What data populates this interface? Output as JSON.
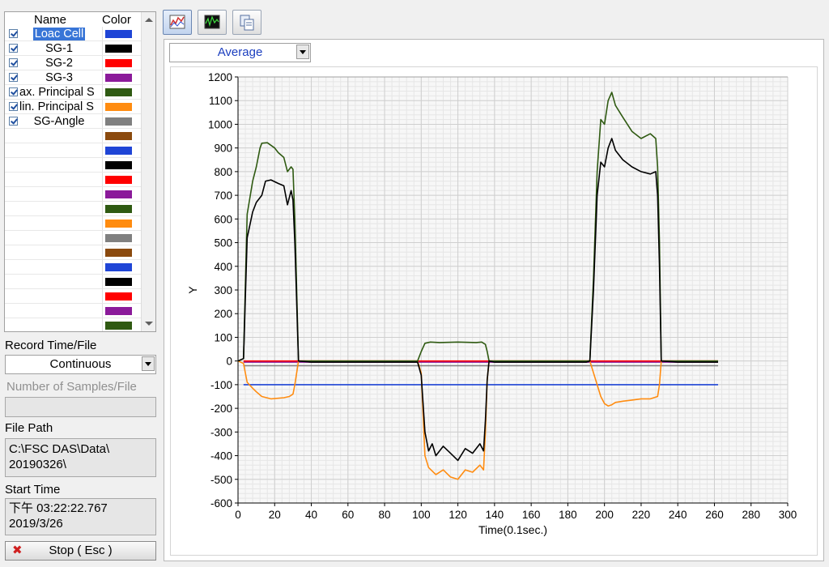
{
  "channel_table": {
    "headers": {
      "name": "Name",
      "color": "Color"
    },
    "rows": [
      {
        "name": "Loac Cell",
        "checked": true,
        "color": "#1f45d6",
        "selected": true
      },
      {
        "name": "SG-1",
        "checked": true,
        "color": "#000000"
      },
      {
        "name": "SG-2",
        "checked": true,
        "color": "#ff0000"
      },
      {
        "name": "SG-3",
        "checked": true,
        "color": "#8b1a9a"
      },
      {
        "name": "ax. Principal S",
        "checked": true,
        "color": "#2f5a12"
      },
      {
        "name": "lin. Principal S",
        "checked": true,
        "color": "#ff8c10"
      },
      {
        "name": "SG-Angle",
        "checked": true,
        "color": "#808080"
      }
    ],
    "extra_swatches": [
      "#8b4a0e",
      "#1f45d6",
      "#000000",
      "#ff0000",
      "#8b1a9a",
      "#2f5a12",
      "#ff8c10",
      "#808080",
      "#8b4a0e",
      "#1f45d6",
      "#000000",
      "#ff0000",
      "#8b1a9a",
      "#2f5a12"
    ]
  },
  "record": {
    "label": "Record Time/File",
    "value": "Continuous",
    "samples_label": "Number of Samples/File",
    "samples_value": ""
  },
  "file": {
    "label": "File Path",
    "line1": "C:\\FSC DAS\\Data\\",
    "line2": "20190326\\"
  },
  "start": {
    "label": "Start Time",
    "line1": "下午 03:22:22.767",
    "line2": "2019/3/26"
  },
  "stop_button": {
    "label": "Stop ( Esc )",
    "icon": "x-icon"
  },
  "toolbar": {
    "icons": [
      "graph-view-icon",
      "strip-chart-icon",
      "copy-icon"
    ]
  },
  "mode_select": {
    "value": "Average"
  },
  "chart_data": {
    "type": "line",
    "xlabel": "Time(0.1sec.)",
    "ylabel": "Y",
    "xlim": [
      0,
      300
    ],
    "ylim": [
      -600,
      1200
    ],
    "xticks": [
      0,
      20,
      40,
      60,
      80,
      100,
      120,
      140,
      160,
      180,
      200,
      220,
      240,
      260,
      280,
      300
    ],
    "yticks": [
      -600,
      -500,
      -400,
      -300,
      -200,
      -100,
      0,
      100,
      200,
      300,
      400,
      500,
      600,
      700,
      800,
      900,
      1000,
      1100,
      1200
    ],
    "grid": true,
    "series": [
      {
        "name": "Loac Cell",
        "color": "#1f45d6",
        "x": [
          3,
          262
        ],
        "y": [
          -100,
          -100
        ]
      },
      {
        "name": "SG-1",
        "color": "#000000",
        "x": [
          0,
          3,
          5,
          8,
          10,
          13,
          15,
          18,
          22,
          25,
          27,
          29,
          30,
          31,
          33,
          40,
          60,
          80,
          98,
          100,
          102,
          104,
          106,
          108,
          112,
          116,
          120,
          124,
          128,
          132,
          134,
          135,
          136,
          137,
          140,
          160,
          190,
          192,
          194,
          196,
          198,
          200,
          202,
          204,
          206,
          210,
          215,
          220,
          225,
          228,
          229,
          230,
          231,
          240,
          262
        ],
        "y": [
          0,
          10,
          520,
          630,
          670,
          700,
          760,
          765,
          750,
          740,
          660,
          720,
          680,
          500,
          0,
          -5,
          -5,
          -5,
          -5,
          -60,
          -300,
          -380,
          -350,
          -400,
          -360,
          -390,
          -420,
          -370,
          -390,
          -350,
          -380,
          -250,
          -80,
          0,
          -5,
          -5,
          -5,
          0,
          300,
          700,
          840,
          820,
          900,
          940,
          890,
          850,
          820,
          800,
          790,
          800,
          700,
          400,
          0,
          -5,
          -5
        ]
      },
      {
        "name": "SG-2",
        "color": "#ff0000",
        "x": [
          3,
          262
        ],
        "y": [
          0,
          0
        ]
      },
      {
        "name": "SG-3",
        "color": "#8b1a9a",
        "x": [
          3,
          262
        ],
        "y": [
          -5,
          -5
        ]
      },
      {
        "name": "ax. Principal S",
        "color": "#2f5a12",
        "x": [
          0,
          3,
          5,
          8,
          10,
          12,
          13,
          16,
          20,
          22,
          25,
          27,
          29,
          30,
          31,
          33,
          40,
          60,
          80,
          98,
          100,
          102,
          105,
          110,
          120,
          130,
          133,
          135,
          136,
          137,
          140,
          160,
          190,
          192,
          194,
          196,
          198,
          200,
          202,
          204,
          206,
          210,
          215,
          220,
          225,
          228,
          229,
          230,
          231,
          240,
          262
        ],
        "y": [
          0,
          10,
          620,
          760,
          820,
          900,
          920,
          922,
          900,
          880,
          860,
          800,
          820,
          810,
          600,
          0,
          0,
          0,
          0,
          0,
          40,
          75,
          80,
          78,
          80,
          78,
          80,
          70,
          40,
          0,
          0,
          0,
          0,
          0,
          350,
          800,
          1020,
          1000,
          1100,
          1135,
          1080,
          1030,
          970,
          940,
          960,
          940,
          820,
          500,
          0,
          0,
          0
        ]
      },
      {
        "name": "lin. Principal S",
        "color": "#ff8c10",
        "x": [
          0,
          3,
          5,
          8,
          10,
          13,
          18,
          25,
          28,
          30,
          31,
          33,
          40,
          60,
          80,
          98,
          100,
          102,
          104,
          108,
          112,
          116,
          120,
          124,
          128,
          132,
          134,
          135,
          136,
          137,
          140,
          160,
          190,
          192,
          194,
          196,
          198,
          200,
          202,
          204,
          206,
          210,
          215,
          220,
          225,
          229,
          230,
          231,
          240,
          262
        ],
        "y": [
          0,
          -10,
          -90,
          -115,
          -130,
          -150,
          -160,
          -155,
          -150,
          -140,
          -100,
          0,
          0,
          0,
          0,
          0,
          -50,
          -400,
          -450,
          -480,
          -460,
          -490,
          -500,
          -460,
          -470,
          -440,
          -460,
          -300,
          -80,
          0,
          0,
          0,
          0,
          0,
          -50,
          -100,
          -150,
          -180,
          -190,
          -185,
          -175,
          -170,
          -165,
          -160,
          -160,
          -150,
          -100,
          0,
          0,
          0
        ]
      },
      {
        "name": "SG-Angle",
        "color": "#808080",
        "x": [
          3,
          262
        ],
        "y": [
          -20,
          -20
        ]
      }
    ]
  }
}
